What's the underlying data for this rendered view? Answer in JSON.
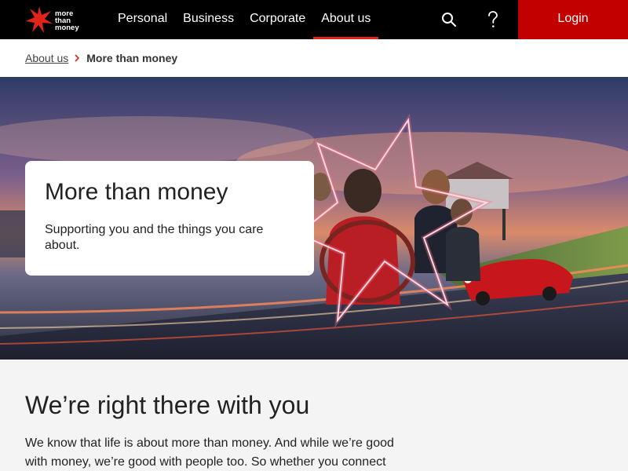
{
  "brand": {
    "logo_text": "more\nthan\nmoney",
    "accent": "#e2231a",
    "login_bg": "#c20000"
  },
  "nav": {
    "items": [
      {
        "label": "Personal"
      },
      {
        "label": "Business"
      },
      {
        "label": "Corporate"
      },
      {
        "label": "About us",
        "active": true
      }
    ]
  },
  "header": {
    "search_icon": "search-icon",
    "help_icon": "question-icon",
    "login_label": "Login"
  },
  "breadcrumb": {
    "parent": "About us",
    "current": "More than money"
  },
  "hero": {
    "title": "More than money",
    "subtitle": "Supporting you and the things you care about."
  },
  "section": {
    "title": "We’re right there with you",
    "body": "We know that life is about more than money. And while we’re good with money, we’re good with people too. So whether you connect with"
  }
}
